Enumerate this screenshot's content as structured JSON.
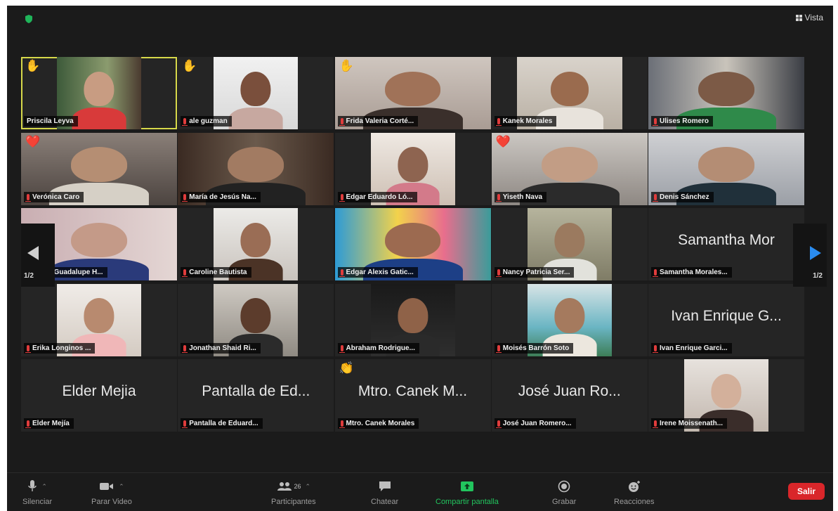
{
  "top": {
    "view_label": "Vista"
  },
  "nav": {
    "left_page": "1/2",
    "right_page": "1/2"
  },
  "participants": [
    {
      "label": "Priscila Leyva",
      "reaction": "✋",
      "kind": "video",
      "active": true
    },
    {
      "label": "ale guzman",
      "reaction": "✋",
      "kind": "video"
    },
    {
      "label": "Frida Valeria Corté...",
      "reaction": "✋",
      "kind": "video"
    },
    {
      "label": "Kanek Morales",
      "kind": "video"
    },
    {
      "label": "Ulises Romero",
      "kind": "video"
    },
    {
      "label": "Verónica Caro",
      "reaction": "❤️",
      "kind": "video"
    },
    {
      "label": "María de Jesús Na...",
      "kind": "video"
    },
    {
      "label": "Edgar Eduardo Ló...",
      "kind": "video"
    },
    {
      "label": "Yiseth Nava",
      "reaction": "❤️",
      "kind": "video"
    },
    {
      "label": "Denis Sánchez",
      "kind": "video"
    },
    {
      "label": "...cela Guadalupe H...",
      "kind": "video"
    },
    {
      "label": "Caroline Bautista",
      "kind": "video"
    },
    {
      "label": "Edgar Alexis Gatic...",
      "kind": "video"
    },
    {
      "label": "Nancy Patricia Ser...",
      "kind": "video"
    },
    {
      "label": "Samantha Morales...",
      "bigname": "Samantha Mor",
      "kind": "name"
    },
    {
      "label": "Erika Longinos ...",
      "kind": "video"
    },
    {
      "label": "Jonathan Shaid Ri...",
      "kind": "video"
    },
    {
      "label": "Abraham Rodrigue...",
      "kind": "video"
    },
    {
      "label": "Moisés Barrón Soto",
      "kind": "video"
    },
    {
      "label": "Ivan Enrique Garci...",
      "bigname": "Ivan Enrique G...",
      "kind": "name"
    },
    {
      "label": "Elder Mejía",
      "bigname": "Elder Mejia",
      "kind": "name"
    },
    {
      "label": "Pantalla de Eduard...",
      "bigname": "Pantalla de Ed...",
      "kind": "name"
    },
    {
      "label": "Mtro. Canek Morales",
      "bigname": "Mtro. Canek M...",
      "reaction": "👏",
      "kind": "name"
    },
    {
      "label": "José Juan Romero...",
      "bigname": "José Juan Ro...",
      "kind": "name"
    },
    {
      "label": "Irene Moissenath...",
      "kind": "video"
    }
  ],
  "toolbar": {
    "mute": "Silenciar",
    "stop_video": "Parar Video",
    "participants": "Participantes",
    "participants_count": "26",
    "chat": "Chatear",
    "share": "Compartir pantalla",
    "record": "Grabar",
    "reactions": "Reacciones",
    "leave": "Salir"
  },
  "colors": {
    "active_border": "#d7d94a",
    "share_green": "#22c55e",
    "leave_red": "#d9262a",
    "nav_blue": "#2a8cf0"
  }
}
